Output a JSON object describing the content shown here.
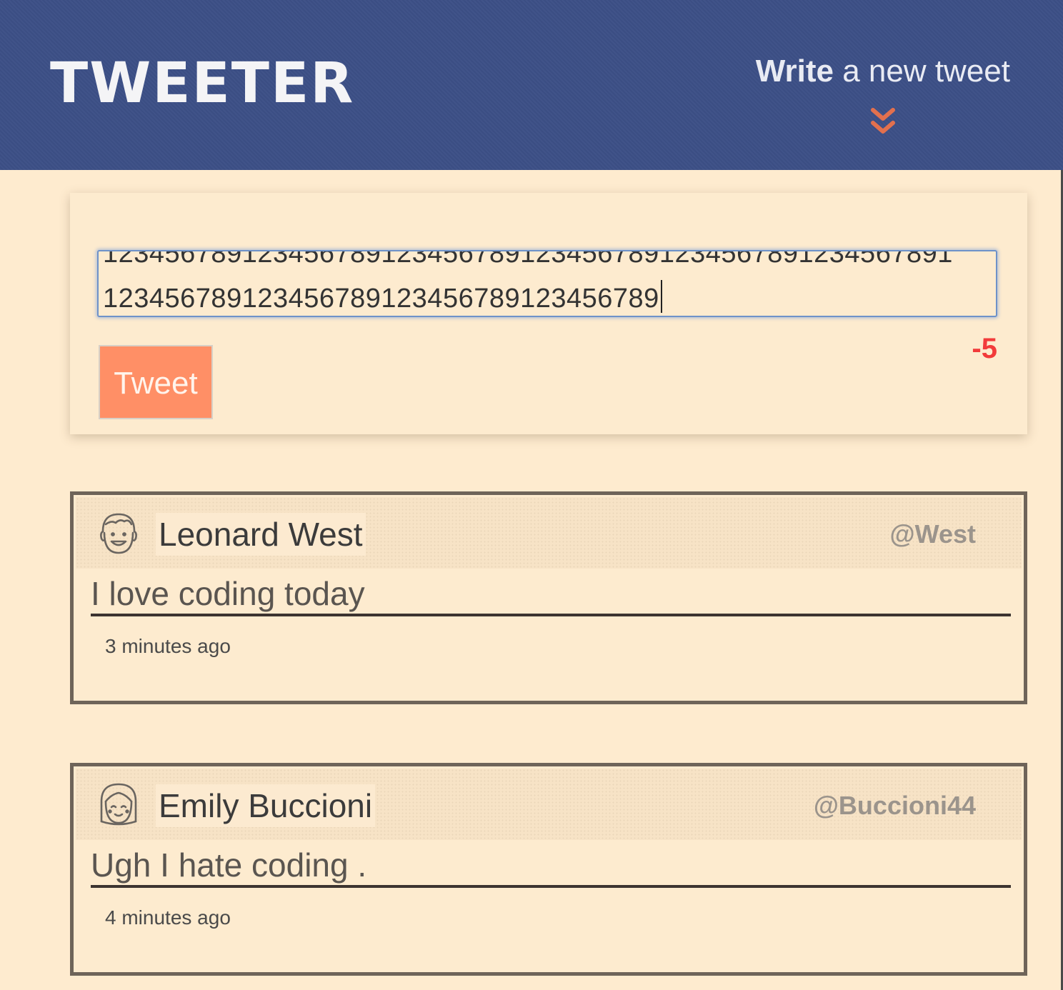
{
  "header": {
    "logo": "TWEETER",
    "compose_toggle": {
      "bold": "Write",
      "rest": " a new tweet",
      "icon": "double-chevron-down-icon",
      "icon_color": "#e2704e"
    },
    "background_color": "#3c4f86"
  },
  "composer": {
    "text_line1": "1234567891234567891234567891234567891234567891234567891",
    "text_line2": "123456789123456789123456789123456789",
    "button_label": "Tweet",
    "counter": "-5",
    "counter_color": "#f23b3b",
    "button_color": "#ff8f66"
  },
  "tweets": [
    {
      "avatar": "boy-face-avatar-icon",
      "name": "Leonard West",
      "handle": "@West",
      "content": "I love coding today",
      "timestamp": "3 minutes ago"
    },
    {
      "avatar": "girl-face-avatar-icon",
      "name": "Emily Buccioni",
      "handle": "@Buccioni44",
      "content": "Ugh I hate coding .",
      "timestamp": "4 minutes ago"
    }
  ]
}
